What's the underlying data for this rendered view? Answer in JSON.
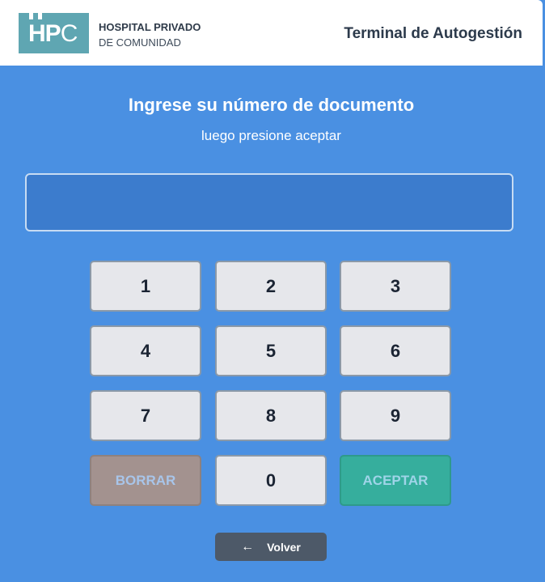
{
  "header": {
    "logo_text_bold": "HP",
    "logo_text_thin": "C",
    "org_line1": "HOSPITAL PRIVADO",
    "org_line2": "DE COMUNIDAD",
    "app_title": "Terminal de Autogestión"
  },
  "prompt": {
    "title": "Ingrese su número de documento",
    "subtitle": "luego presione aceptar"
  },
  "document_input": {
    "value": "",
    "placeholder": ""
  },
  "keypad": {
    "keys": [
      "1",
      "2",
      "3",
      "4",
      "5",
      "6",
      "7",
      "8",
      "9"
    ],
    "clear_label": "BORRAR",
    "zero_label": "0",
    "accept_label": "ACEPTAR"
  },
  "back_button": {
    "icon": "←",
    "label": "Volver"
  },
  "colors": {
    "background": "#4a90e2",
    "logo": "#5fa6b2",
    "accept": "#36ae9d",
    "clear": "#a3928f",
    "back": "#4d5968"
  }
}
